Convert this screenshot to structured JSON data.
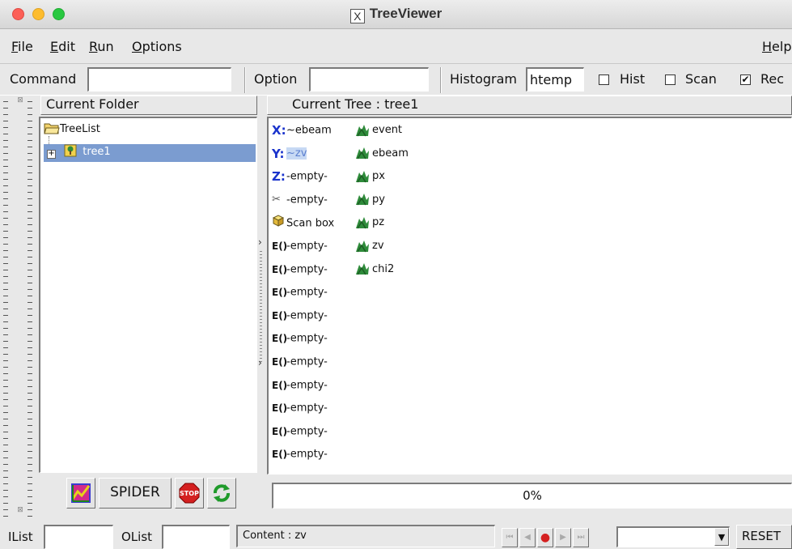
{
  "window": {
    "title": "TreeViewer",
    "logo_glyph": "X"
  },
  "menu": {
    "file": {
      "ul": "F",
      "rest": "ile"
    },
    "edit": {
      "ul": "E",
      "rest": "dit"
    },
    "run": {
      "ul": "R",
      "rest": "un"
    },
    "options": {
      "ul": "O",
      "rest": "ptions"
    },
    "help": {
      "ul": "H",
      "rest": "elp"
    }
  },
  "toolbar": {
    "command_label": "Command",
    "command_value": "",
    "option_label": "Option",
    "option_value": "",
    "histogram_label": "Histogram",
    "histogram_value": "htemp",
    "hist_label": "Hist",
    "hist_checked": false,
    "scan_label": "Scan",
    "scan_checked": false,
    "rec_label": "Rec",
    "rec_checked": true
  },
  "folder": {
    "header": "Current Folder",
    "items": [
      {
        "label": "TreeList"
      },
      {
        "label": "tree1",
        "expander": "+"
      }
    ]
  },
  "tree": {
    "header": "Current Tree : tree1",
    "left_items": [
      {
        "icon": "X:",
        "label": "~ebeam"
      },
      {
        "icon": "Y:",
        "label": "~zv"
      },
      {
        "icon": "Z:",
        "label": "-empty-"
      },
      {
        "icon": "scissors",
        "label": "-empty-"
      },
      {
        "icon": "box",
        "label": "Scan box"
      },
      {
        "icon": "E()",
        "label": "-empty-"
      },
      {
        "icon": "E()",
        "label": "-empty-"
      },
      {
        "icon": "E()",
        "label": "-empty-"
      },
      {
        "icon": "E()",
        "label": "-empty-"
      },
      {
        "icon": "E()",
        "label": "-empty-"
      },
      {
        "icon": "E()",
        "label": "-empty-"
      },
      {
        "icon": "E()",
        "label": "-empty-"
      },
      {
        "icon": "E()",
        "label": "-empty-"
      },
      {
        "icon": "E()",
        "label": "-empty-"
      },
      {
        "icon": "E()",
        "label": "-empty-"
      }
    ],
    "leaves": [
      "event",
      "ebeam",
      "px",
      "py",
      "pz",
      "zv",
      "chi2"
    ]
  },
  "tools": {
    "spider_label": "SPIDER",
    "stop_label": "STOP"
  },
  "progress": {
    "text": "0%",
    "value": 0
  },
  "status": {
    "ilist_label": "IList",
    "olist_label": "OList",
    "content": "Content : zv",
    "reset_label": "RESET"
  },
  "colors": {
    "selection": "#7b9cd0",
    "axis_icon": "#1a33cc",
    "leaf": "#2e8b3a"
  }
}
